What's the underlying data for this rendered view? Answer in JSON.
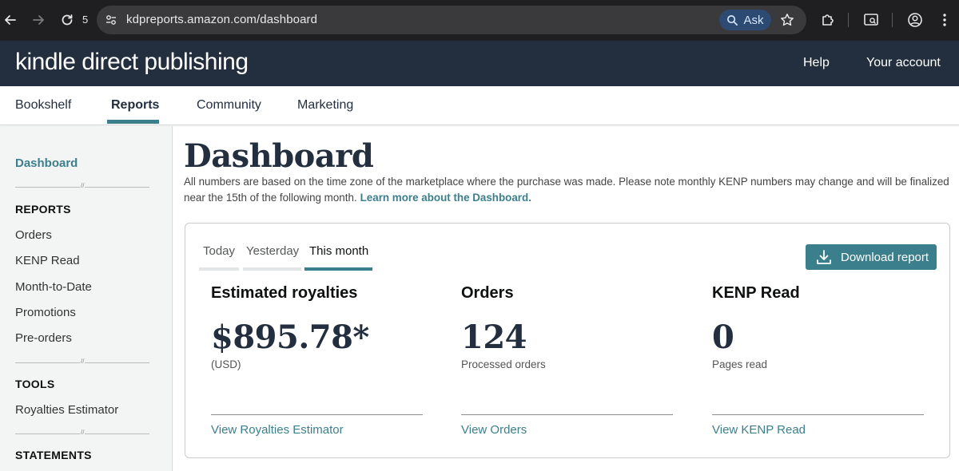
{
  "browser": {
    "reload_count": "5",
    "url": "kdpreports.amazon.com/dashboard",
    "ask_label": "Ask"
  },
  "header": {
    "logo_part1": "kindle",
    "logo_part2": " direct publishing",
    "help": "Help",
    "account": "Your account"
  },
  "tabs": [
    {
      "label": "Bookshelf"
    },
    {
      "label": "Reports"
    },
    {
      "label": "Community"
    },
    {
      "label": "Marketing"
    }
  ],
  "sidebar": {
    "dashboard": "Dashboard",
    "reports_heading": "REPORTS",
    "reports_items": [
      "Orders",
      "KENP Read",
      "Month-to-Date",
      "Promotions",
      "Pre-orders"
    ],
    "tools_heading": "TOOLS",
    "tools_items": [
      "Royalties Estimator"
    ],
    "statements_heading": "STATEMENTS"
  },
  "main": {
    "title": "Dashboard",
    "intro": "All numbers are based on the time zone of the marketplace where the purchase was made. Please note monthly KENP numbers may change and will be finalized near the 15th of the following month.",
    "learn_more": "Learn more about the Dashboard."
  },
  "card": {
    "periods": [
      "Today",
      "Yesterday",
      "This month"
    ],
    "selected_period": "This month",
    "download": "Download report",
    "metrics": [
      {
        "title": "Estimated royalties",
        "value": "$895.78*",
        "sub": "(USD)",
        "link": "View Royalties Estimator"
      },
      {
        "title": "Orders",
        "value": "124",
        "sub": "Processed orders",
        "link": "View Orders"
      },
      {
        "title": "KENP Read",
        "value": "0",
        "sub": "Pages read",
        "link": "View KENP Read"
      }
    ]
  },
  "colors": {
    "accent": "#3c7f8c",
    "header_bg": "#232f3e",
    "browser_bg": "#1f1f21"
  }
}
